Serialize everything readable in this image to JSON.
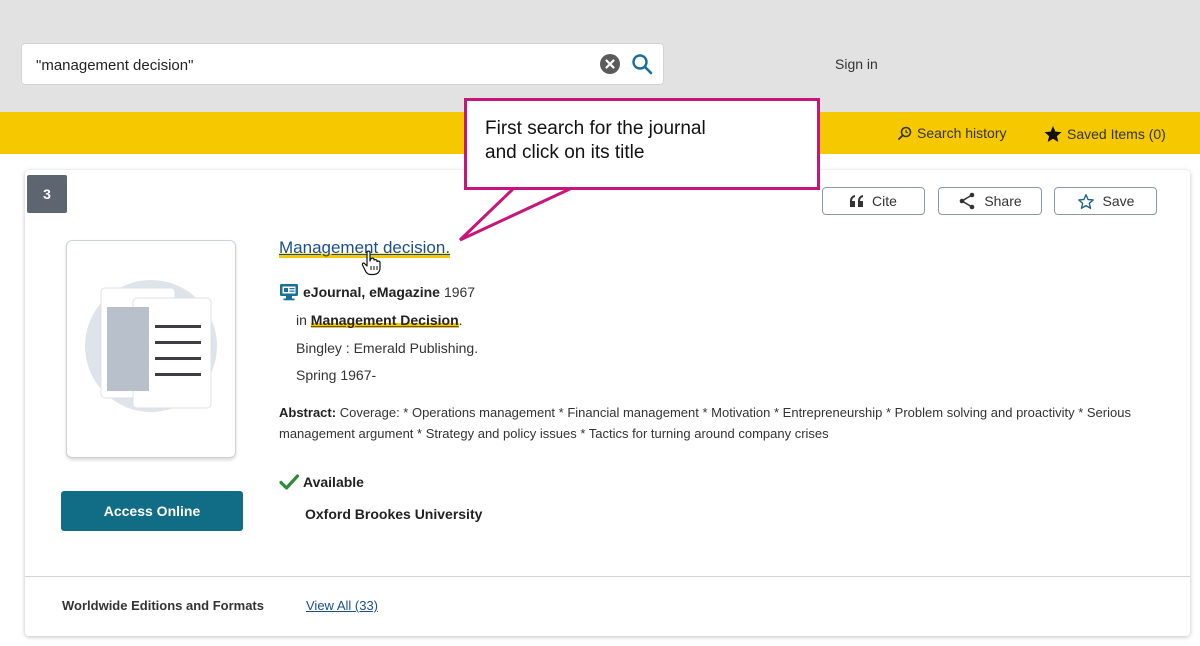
{
  "search": {
    "query": "\"management decision\""
  },
  "header": {
    "sign_in": "Sign in"
  },
  "toolbar": {
    "search_history": "Search history",
    "saved_items": "Saved Items (0)"
  },
  "callout": {
    "line1": "First search for the journal",
    "line2": "and click on its title"
  },
  "result": {
    "number": "3",
    "actions": {
      "cite": "Cite",
      "share": "Share",
      "save": "Save"
    },
    "title": "Management decision.",
    "format_label": "eJournal, eMagazine",
    "year": "1967",
    "in_prefix": "in",
    "in_word1": "Management",
    "in_word2": "Decision",
    "publisher": "Bingley : Emerald Publishing.",
    "dates": "Spring 1967-",
    "abstract_label": "Abstract:",
    "abstract_text": "Coverage: * Operations management * Financial management * Motivation * Entrepreneurship * Problem solving and proactivity * Serious management argument * Strategy and policy issues * Tactics for turning around company crises",
    "availability": "Available",
    "library": "Oxford Brookes University",
    "access_button": "Access Online",
    "editions_label": "Worldwide Editions and Formats",
    "view_all": "View All (33)"
  },
  "colors": {
    "brand_yellow": "#f5c800",
    "access_teal": "#116d86",
    "callout_border": "#c8157a",
    "link_blue": "#1a4f8b",
    "available_green": "#2e8b3a"
  },
  "icons": [
    "clear-icon",
    "search-icon",
    "search-history-icon",
    "star-filled-icon",
    "quote-icon",
    "share-icon",
    "star-outline-icon",
    "ejournal-icon",
    "checkmark-icon",
    "hand-cursor-icon",
    "document-cover-icon"
  ]
}
